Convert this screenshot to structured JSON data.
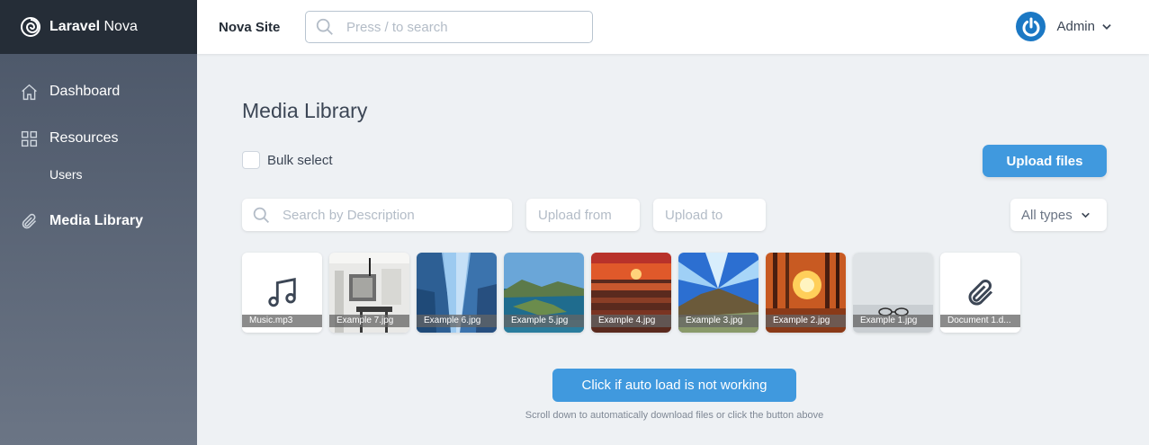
{
  "brand": {
    "name_bold": "Laravel",
    "name_regular": " Nova",
    "icon": "nova-logo-icon"
  },
  "sidebar": {
    "items": [
      {
        "label": "Dashboard",
        "icon": "home-icon"
      },
      {
        "label": "Resources",
        "icon": "grid-icon"
      },
      {
        "label": "Users"
      },
      {
        "label": "Media Library",
        "icon": "paperclip-icon"
      }
    ]
  },
  "header": {
    "site_name": "Nova Site",
    "search_placeholder": "Press / to search",
    "user_name": "Admin"
  },
  "main": {
    "title": "Media Library",
    "bulk_select_label": "Bulk select",
    "upload_button": "Upload files",
    "filters": {
      "search_placeholder": "Search by Description",
      "upload_from_placeholder": "Upload from",
      "upload_to_placeholder": "Upload to",
      "type_selected": "All types"
    },
    "files": [
      {
        "name": "Music.mp3",
        "kind": "audio",
        "icon": "music-note-icon"
      },
      {
        "name": "Example 7.jpg",
        "kind": "image"
      },
      {
        "name": "Example 6.jpg",
        "kind": "image"
      },
      {
        "name": "Example 5.jpg",
        "kind": "image"
      },
      {
        "name": "Example 4.jpg",
        "kind": "image"
      },
      {
        "name": "Example 3.jpg",
        "kind": "image"
      },
      {
        "name": "Example 2.jpg",
        "kind": "image"
      },
      {
        "name": "Example 1.jpg",
        "kind": "image"
      },
      {
        "name": "Document 1.d...",
        "kind": "document",
        "icon": "paperclip-icon"
      }
    ],
    "autoload_button": "Click if auto load is not working",
    "hint": "Scroll down to automatically download files or click the button above"
  },
  "colors": {
    "accent": "#4099de",
    "sidebar_top": "#252d37",
    "avatar": "#1b78c4"
  }
}
